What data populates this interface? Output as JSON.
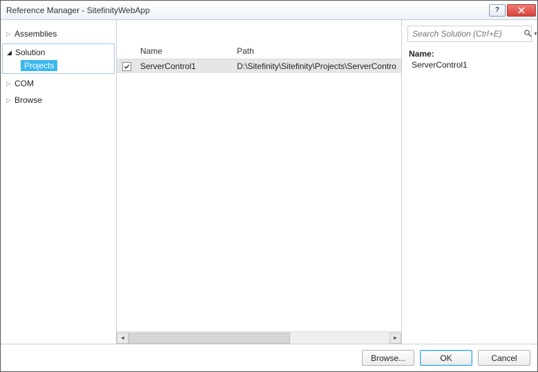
{
  "window": {
    "title": "Reference Manager - SitefinityWebApp"
  },
  "sidebar": {
    "items": [
      {
        "label": "Assemblies",
        "expanded": false
      },
      {
        "label": "Solution",
        "expanded": true,
        "children": [
          {
            "label": "Projects",
            "selected": true
          }
        ]
      },
      {
        "label": "COM",
        "expanded": false
      },
      {
        "label": "Browse",
        "expanded": false
      }
    ]
  },
  "list": {
    "columns": {
      "name": "Name",
      "path": "Path"
    },
    "rows": [
      {
        "checked": true,
        "name": "ServerControl1",
        "path": "D:\\Sitefinity\\Sitefinity\\Projects\\ServerContro"
      }
    ]
  },
  "search": {
    "placeholder": "Search Solution (Ctrl+E)"
  },
  "details": {
    "name_label": "Name:",
    "name_value": "ServerControl1"
  },
  "footer": {
    "browse": "Browse...",
    "ok": "OK",
    "cancel": "Cancel"
  }
}
